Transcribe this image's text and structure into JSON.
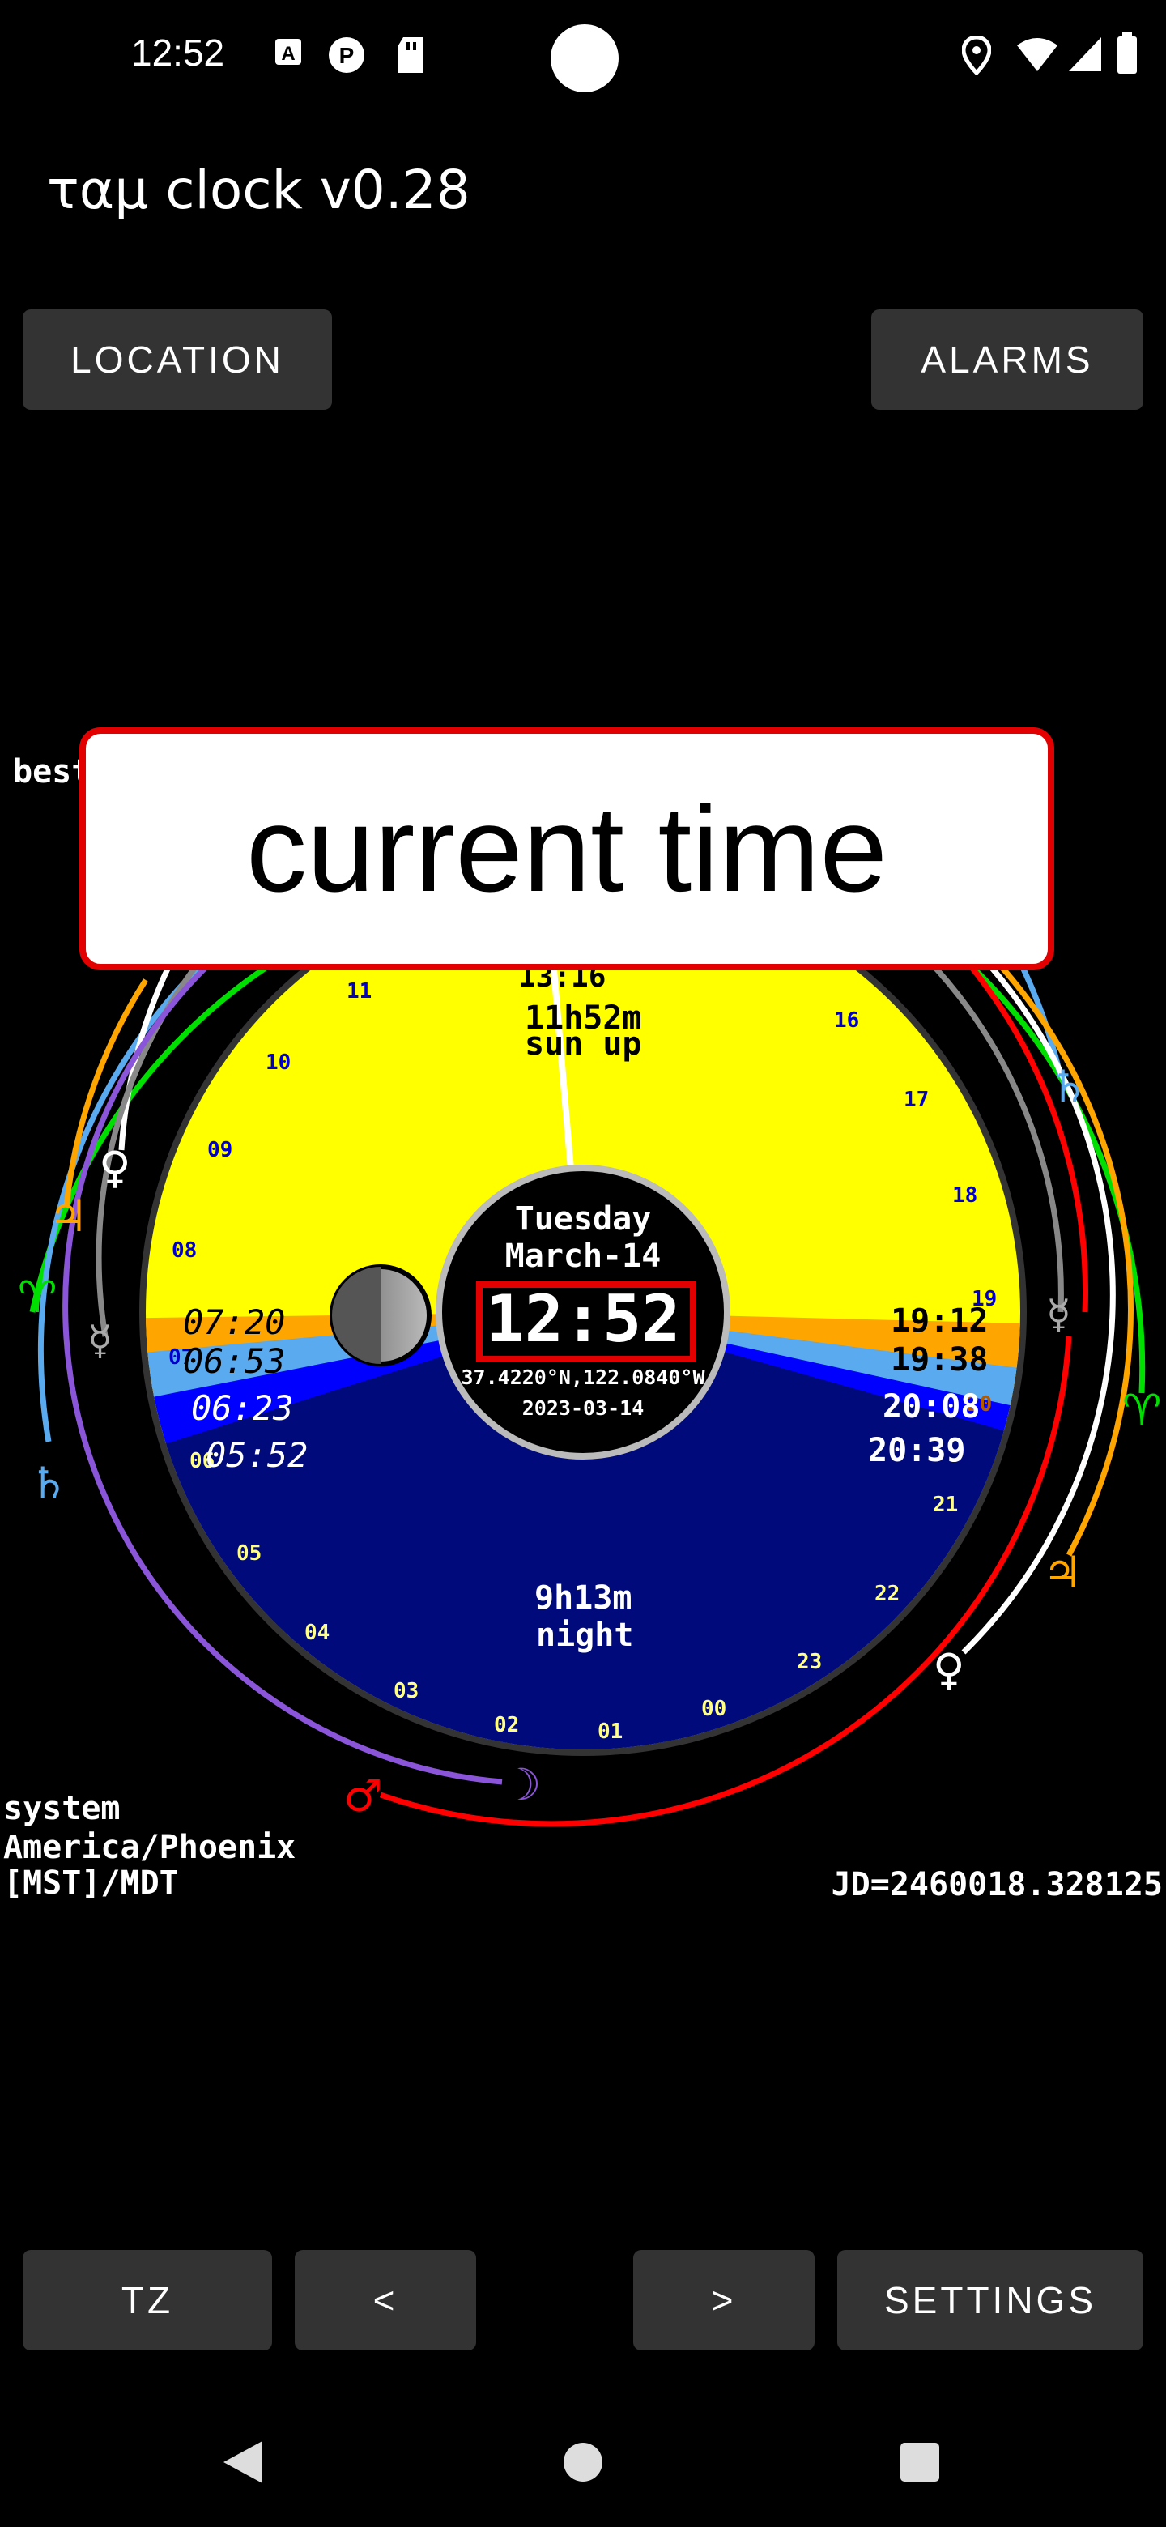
{
  "status_bar": {
    "time": "12:52",
    "left_icons": [
      "a-icon",
      "p-icon",
      "sdcard-icon"
    ],
    "right_icons": [
      "location-icon",
      "wifi-icon",
      "signal-icon",
      "battery-icon"
    ]
  },
  "app": {
    "title": "ταμ clock v0.28"
  },
  "top_buttons": {
    "location": "LOCATION",
    "alarms": "ALARMS"
  },
  "overlay": {
    "label": "current time"
  },
  "partial_left_text": "best",
  "clock": {
    "weekday": "Tuesday",
    "date": "March-14",
    "time": "12:52",
    "coords": "37.4220°N,122.0840°W",
    "iso_date": "2023-03-14",
    "partial_top": "13:16",
    "daylight": "11h52m",
    "daylight_label": "sun up",
    "night": "9h13m",
    "night_label": "night",
    "left_times": [
      "07:20",
      "06:53",
      "06:23",
      "05:52"
    ],
    "right_times": [
      "19:12",
      "19:38",
      "20:08",
      "20:39"
    ],
    "hour_labels": [
      "00",
      "01",
      "02",
      "03",
      "04",
      "05",
      "06",
      "07",
      "08",
      "09",
      "10",
      "11",
      "16",
      "17",
      "18",
      "19",
      "20",
      "21",
      "22",
      "23"
    ]
  },
  "info": {
    "tz_source": "system",
    "tz_name": "America/Phoenix",
    "tz_abbrev": "[MST]/MDT",
    "jd": "JD=2460018.328125"
  },
  "bottom_buttons": {
    "tz": "TZ",
    "prev": "<",
    "next": ">",
    "settings": "SETTINGS"
  },
  "colors": {
    "day": "#ffff00",
    "civil": "#ffa500",
    "nautical": "#5aaaf0",
    "astronomical": "#0000ff",
    "night": "#000a7a",
    "overlay_border": "#e30000"
  }
}
